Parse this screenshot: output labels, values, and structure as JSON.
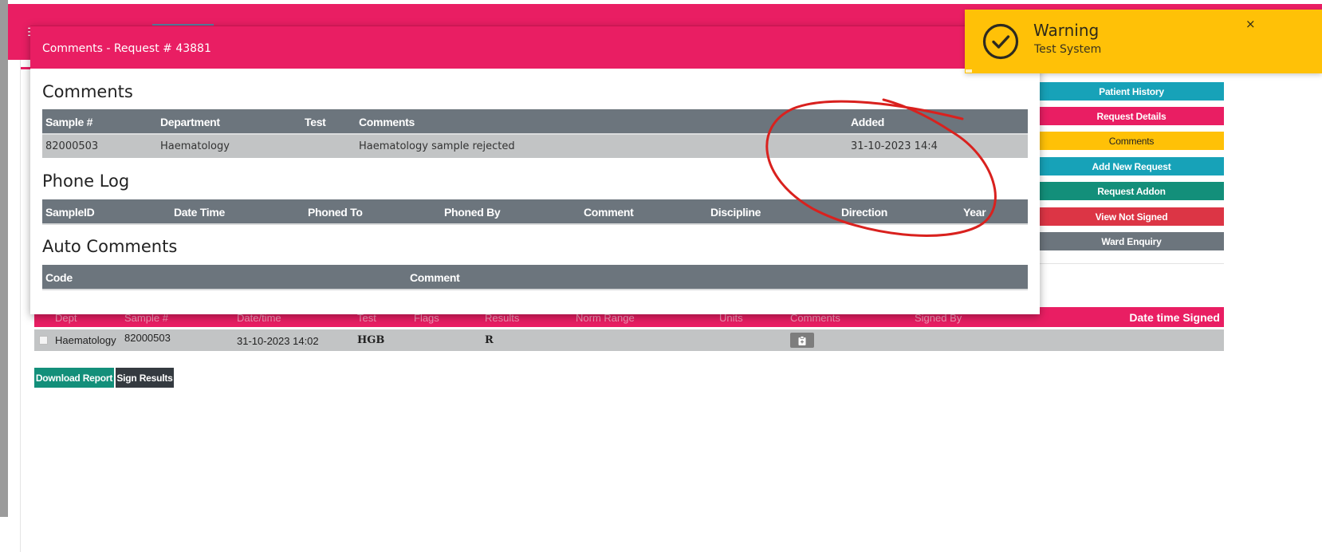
{
  "modal": {
    "title": "Comments - Request # 43881",
    "comments": {
      "title": "Comments",
      "headers": [
        "Sample #",
        "Department",
        "Test",
        "Comments",
        "Added"
      ],
      "rows": [
        [
          "82000503",
          "Haematology",
          "",
          "Haematology sample rejected",
          "31-10-2023 14:4"
        ]
      ]
    },
    "phone_log": {
      "title": "Phone Log",
      "headers": [
        "SampleID",
        "Date Time",
        "Phoned To",
        "Phoned By",
        "Comment",
        "Discipline",
        "Direction",
        "Year"
      ]
    },
    "auto_comments": {
      "title": "Auto Comments",
      "headers": [
        "Code",
        "Comment"
      ]
    }
  },
  "toast": {
    "title": "Warning",
    "message": "Test System",
    "close": "×",
    "icon": "check-circle-icon"
  },
  "topbar": {
    "menu_icon": "menu-icon",
    "menu_glyph": "☰"
  },
  "side_buttons": [
    "Patient History",
    "Request Details",
    "Comments",
    "Add New Request",
    "Request Addon",
    "View Not Signed",
    "Ward Enquiry"
  ],
  "results": {
    "headers": [
      "Dept",
      "Sample #",
      "Date/time",
      "Test",
      "Flags",
      "Results",
      "Norm Range",
      "Units",
      "Comments",
      "Signed By",
      "Date time Signed"
    ],
    "rows": [
      {
        "dept": "Haematology",
        "sample": "82000503",
        "datetime": "31-10-2023 14:02",
        "test": "HGB",
        "result": "R"
      }
    ]
  },
  "actions": {
    "download": "Download Report",
    "sign": "Sign Results"
  },
  "colors": {
    "brand_pink": "#e91e63",
    "teal": "#17a2b8",
    "warning": "#ffc107",
    "green": "#138f7a",
    "danger": "#dc3545",
    "gray": "#6c757d",
    "annotation_red": "#d9211e"
  }
}
